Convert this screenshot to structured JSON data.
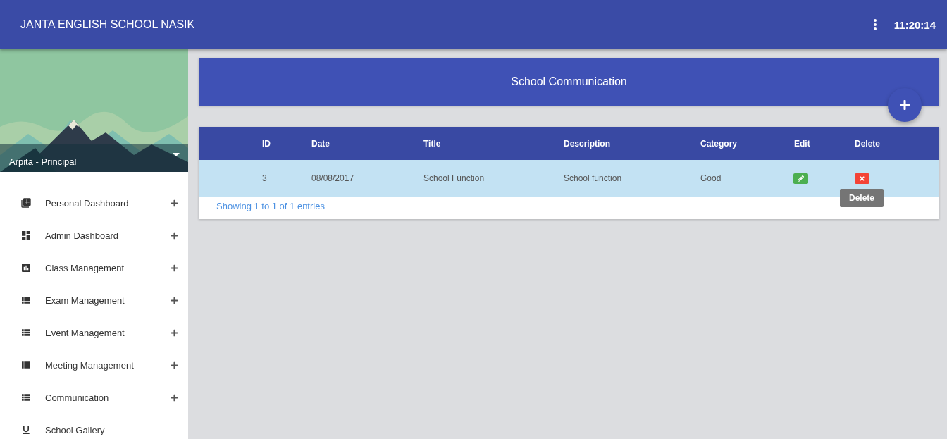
{
  "header": {
    "title": "JANTA ENGLISH SCHOOL NASIK",
    "time": "11:20:14"
  },
  "sidebar": {
    "user": "Arpita - Principal",
    "items": [
      {
        "label": "Personal Dashboard",
        "expandable": true
      },
      {
        "label": "Admin Dashboard",
        "expandable": true
      },
      {
        "label": "Class Management",
        "expandable": true
      },
      {
        "label": "Exam Management",
        "expandable": true
      },
      {
        "label": "Event Management",
        "expandable": true
      },
      {
        "label": "Meeting Management",
        "expandable": true
      },
      {
        "label": "Communication",
        "expandable": true
      },
      {
        "label": "School Gallery",
        "expandable": false
      }
    ]
  },
  "page_title": "School Communication",
  "table": {
    "columns": [
      "ID",
      "Date",
      "Title",
      "Description",
      "Category",
      "Edit",
      "Delete"
    ],
    "rows": [
      {
        "cells": [
          "3",
          "08/08/2017",
          "School Function",
          "School function",
          "Good"
        ],
        "selected": true
      }
    ],
    "tooltip": "Delete",
    "footer": "Showing 1 to 1 of 1 entries"
  }
}
